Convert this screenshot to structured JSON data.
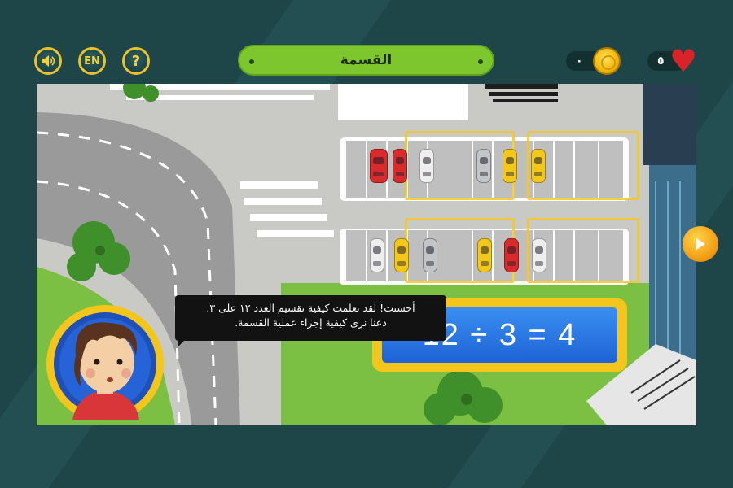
{
  "header": {
    "sound_button_icon": "speaker-icon",
    "language_label": "EN",
    "help_label": "?",
    "title": "القسمة",
    "coins": "٠",
    "lives": "٥"
  },
  "equation": {
    "text": "12 ÷ 3 = 4"
  },
  "dialog": {
    "line1": "أحسنت! لقد تعلمت كيفية تقسيم العدد ١٢ على ٣.",
    "line2": "دعنا نرى كيفية إجراء عملية القسمة."
  },
  "colors": {
    "background": "#1e4548",
    "accent": "#e9c12b",
    "title_pill": "#7ec62e",
    "equation_bg": "#2a78e4",
    "heart": "#d8232a"
  },
  "next_button_icon": "play-icon"
}
